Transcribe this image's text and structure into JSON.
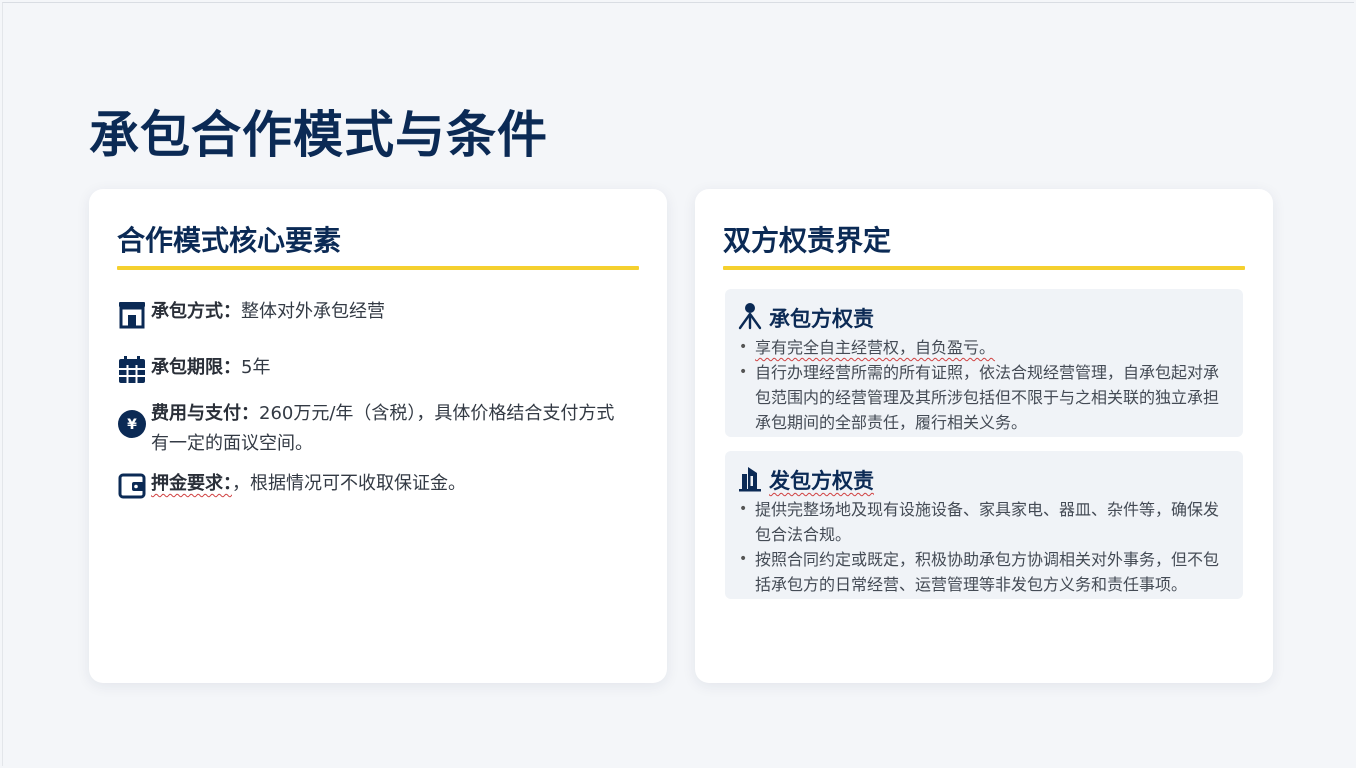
{
  "slide": {
    "title": "承包合作模式与条件"
  },
  "left_card": {
    "title": "合作模式核心要素",
    "items": [
      {
        "icon": "store-icon",
        "label": "承包方式：",
        "value": "整体对外承包经营"
      },
      {
        "icon": "calendar-icon",
        "label": "承包期限：",
        "value": "5年"
      },
      {
        "icon": "yen-coin-icon",
        "label": "费用与支付：",
        "value": "260万元/年（含税），具体价格结合支付方式有一定的面议空间。"
      },
      {
        "icon": "wallet-icon",
        "label": "押金要求：",
        "value": "，根据情况可不收取保证金。"
      }
    ]
  },
  "right_card": {
    "title": "双方权责界定",
    "panels": [
      {
        "icon": "person-icon",
        "title": "承包方权责",
        "bullets": [
          "享有完全自主经营权，自负盈亏。",
          "自行办理经营所需的所有证照，依法合规经营管理，自承包起对承包范围内的经营管理及其所涉包括但不限于与之相关联的独立承担承包期间的全部责任，履行相关义务。"
        ]
      },
      {
        "icon": "building-icon",
        "title": "发包方权责",
        "bullets": [
          "提供完整场地及现有设施设备、家具家电、器皿、杂件等，确保发包合法合规。",
          "按照合同约定或既定，积极协助承包方协调相关对外事务，但不包括承包方的日常经营、运营管理等非发包方义务和责任事项。"
        ]
      }
    ]
  },
  "colors": {
    "navy": "#0b2a55",
    "accent_yellow": "#f5d02e",
    "panel_bg": "#f0f3f7",
    "background": "#f4f6f9"
  }
}
